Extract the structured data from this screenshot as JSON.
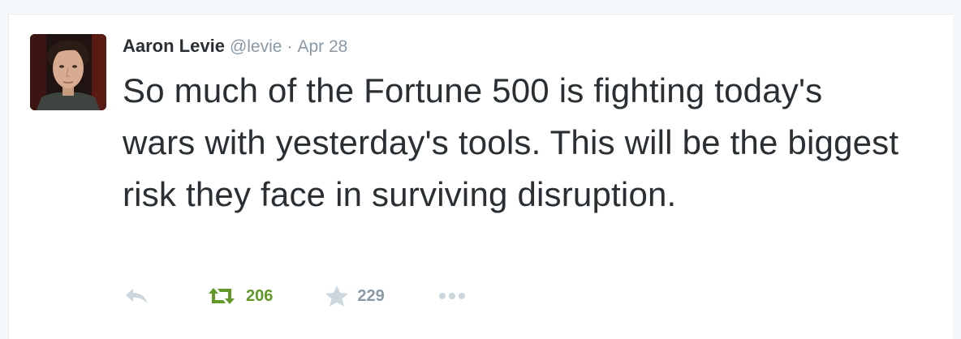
{
  "tweet": {
    "author": {
      "display_name": "Aaron Levie",
      "handle": "@levie"
    },
    "separator": "·",
    "timestamp": "Apr 28",
    "text": "So much of the Fortune 500 is fighting today's wars with yesterday's tools. This will be the biggest risk they face in surviving disruption.",
    "actions": {
      "reply_icon": "reply-icon",
      "retweet_icon": "retweet-icon",
      "retweet_count": "206",
      "retweet_color": "#609928",
      "favorite_icon": "star-icon",
      "favorite_count": "229",
      "more_icon": "more-dots-icon",
      "muted_color": "#ccd6dd"
    }
  }
}
